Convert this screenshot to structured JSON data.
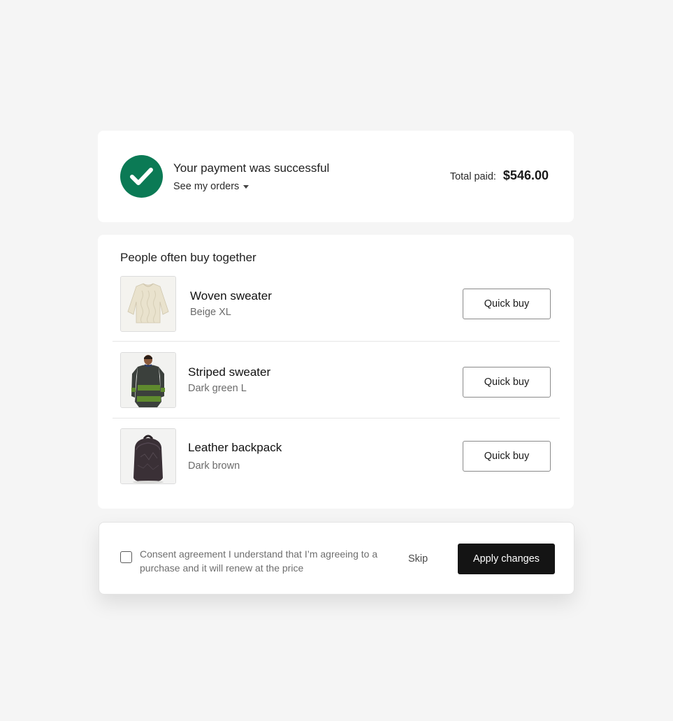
{
  "payment": {
    "title": "Your payment was successful",
    "orders_link": "See my orders",
    "total_label": "Total paid:",
    "total_value": "$546.00",
    "success_color": "#0b7a55",
    "icon": "checkmark-icon"
  },
  "recommendations": {
    "heading": "People often buy together",
    "products": [
      {
        "name": "Woven sweater",
        "variant": "Beige XL",
        "button": "Quick buy",
        "image": "beige-sweater-image"
      },
      {
        "name": "Striped sweater",
        "variant": "Dark green L",
        "button": "Quick buy",
        "image": "striped-sweater-model-image"
      },
      {
        "name": "Leather backpack",
        "variant": "Dark brown",
        "button": "Quick buy",
        "image": "leather-backpack-image"
      }
    ]
  },
  "footer": {
    "consent_text": "Consent agreement I understand that I’m agreeing to a purchase and it will renew at the price",
    "skip_label": "Skip",
    "apply_label": "Apply changes",
    "consent_checked": false
  }
}
